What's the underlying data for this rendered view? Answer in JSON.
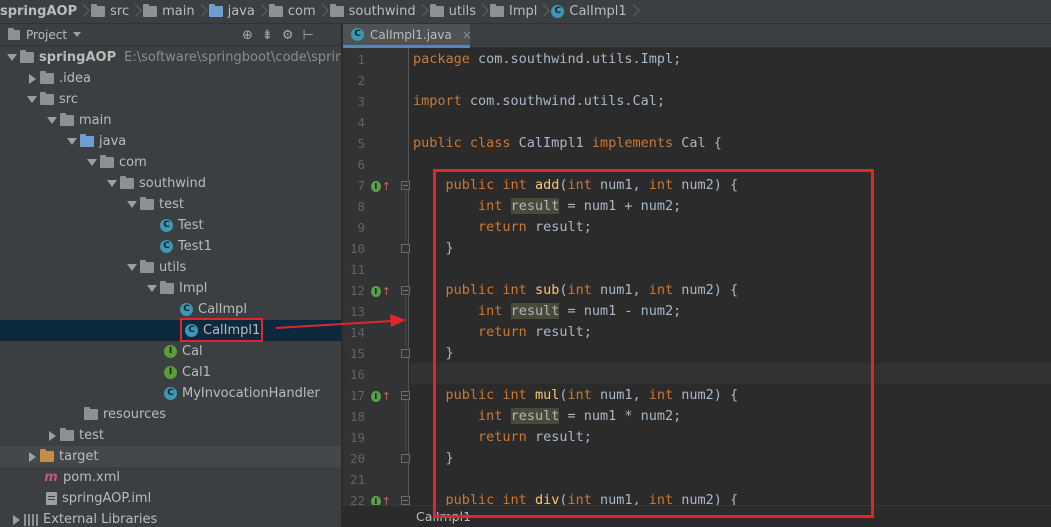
{
  "breadcrumb": {
    "items": [
      {
        "label": "springAOP",
        "icon": "folder-icon"
      },
      {
        "label": "src",
        "icon": "folder-icon"
      },
      {
        "label": "main",
        "icon": "folder-icon"
      },
      {
        "label": "java",
        "icon": "folder-blue-icon"
      },
      {
        "label": "com",
        "icon": "folder-icon"
      },
      {
        "label": "southwind",
        "icon": "folder-icon"
      },
      {
        "label": "utils",
        "icon": "folder-icon"
      },
      {
        "label": "Impl",
        "icon": "folder-icon"
      },
      {
        "label": "CalImpl1",
        "icon": "class-icon"
      }
    ]
  },
  "project_panel": {
    "title": "Project",
    "root": {
      "name": "springAOP",
      "path": "E:\\software\\springboot\\code\\springAOP"
    },
    "nodes": {
      "idea": ".idea",
      "src": "src",
      "main": "main",
      "java": "java",
      "com": "com",
      "southwind": "southwind",
      "test_pkg": "test",
      "test_class": "Test",
      "test1_class": "Test1",
      "utils": "utils",
      "impl": "Impl",
      "calimpl": "CalImpl",
      "calimpl1": "CalImpl1",
      "cal": "Cal",
      "cal1": "Cal1",
      "handler": "MyInvocationHandler",
      "resources": "resources",
      "test_dir": "test",
      "target": "target",
      "pom": "pom.xml",
      "iml": "springAOP.iml",
      "libs": "External Libraries"
    },
    "icon_letters": {
      "class": "C",
      "interface": "I"
    }
  },
  "editor": {
    "tab_label": "CalImpl1.java",
    "tab_close": "×",
    "override_marker": "I",
    "override_arrow": "↑",
    "line_numbers": [
      "1",
      "2",
      "3",
      "4",
      "5",
      "6",
      "7",
      "8",
      "9",
      "10",
      "11",
      "12",
      "13",
      "14",
      "15",
      "16",
      "17",
      "18",
      "19",
      "20",
      "21",
      "22"
    ],
    "status_breadcrumb": "CalImpl1"
  },
  "colors": {
    "background": "#2b2b2b",
    "panel": "#3c3f41",
    "keyword": "#cc7832",
    "method": "#ffc66d",
    "text": "#a9b7c6",
    "annotation": "#e0262d",
    "selection": "#0d293e"
  }
}
